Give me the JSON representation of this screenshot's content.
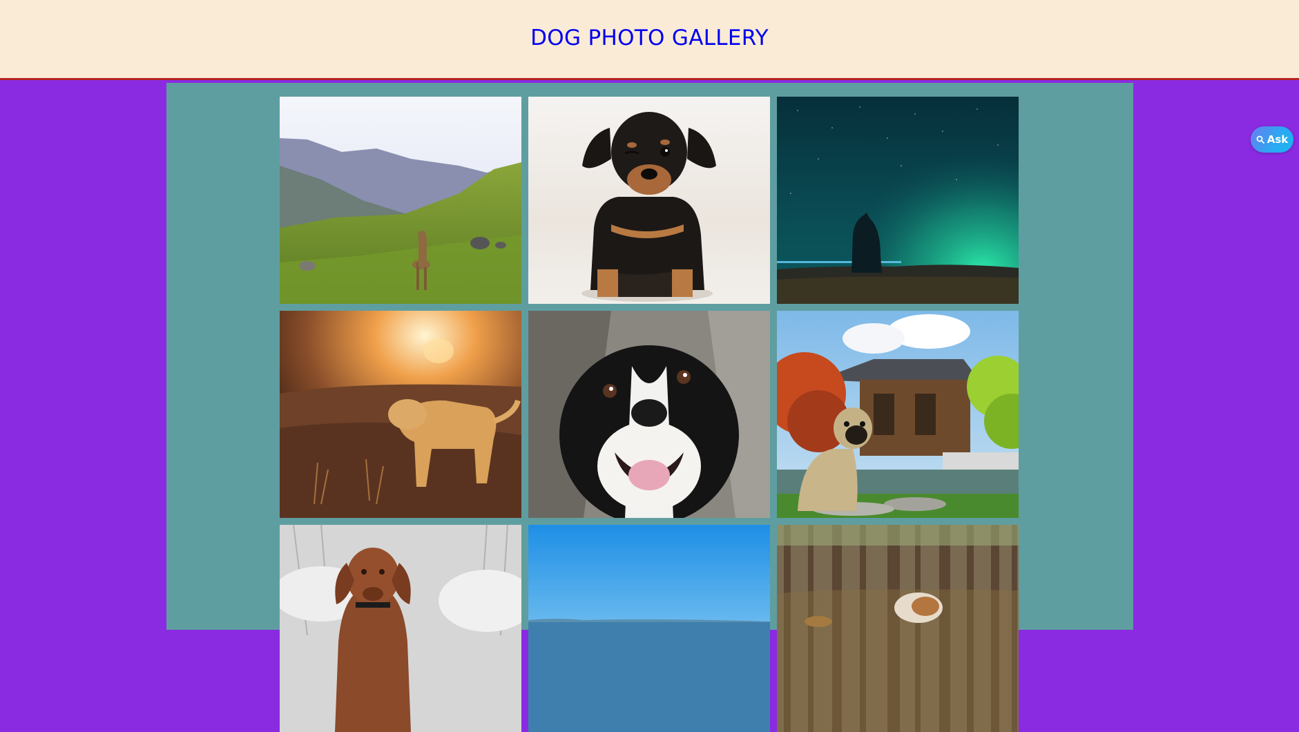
{
  "header": {
    "title": "DOG PHOTO GALLERY"
  },
  "ask_button": {
    "label": "Ask",
    "icon": "magnifier-icon"
  },
  "gallery": {
    "photos": [
      {
        "subject": "dog on mountain meadow"
      },
      {
        "subject": "black and tan puppy"
      },
      {
        "subject": "dog under aurora sky"
      },
      {
        "subject": "golden retriever at sunset"
      },
      {
        "subject": "happy black and white dog"
      },
      {
        "subject": "pug by pagoda"
      },
      {
        "subject": "vizsla in snowy forest"
      },
      {
        "subject": "sky over sea"
      },
      {
        "subject": "dog in pine forest"
      }
    ]
  },
  "colors": {
    "page_bg": "#8a2be2",
    "header_bg": "#faebd7",
    "header_border": "#b22222",
    "title_color": "#0000ee",
    "main_bg": "#5f9ea0"
  }
}
